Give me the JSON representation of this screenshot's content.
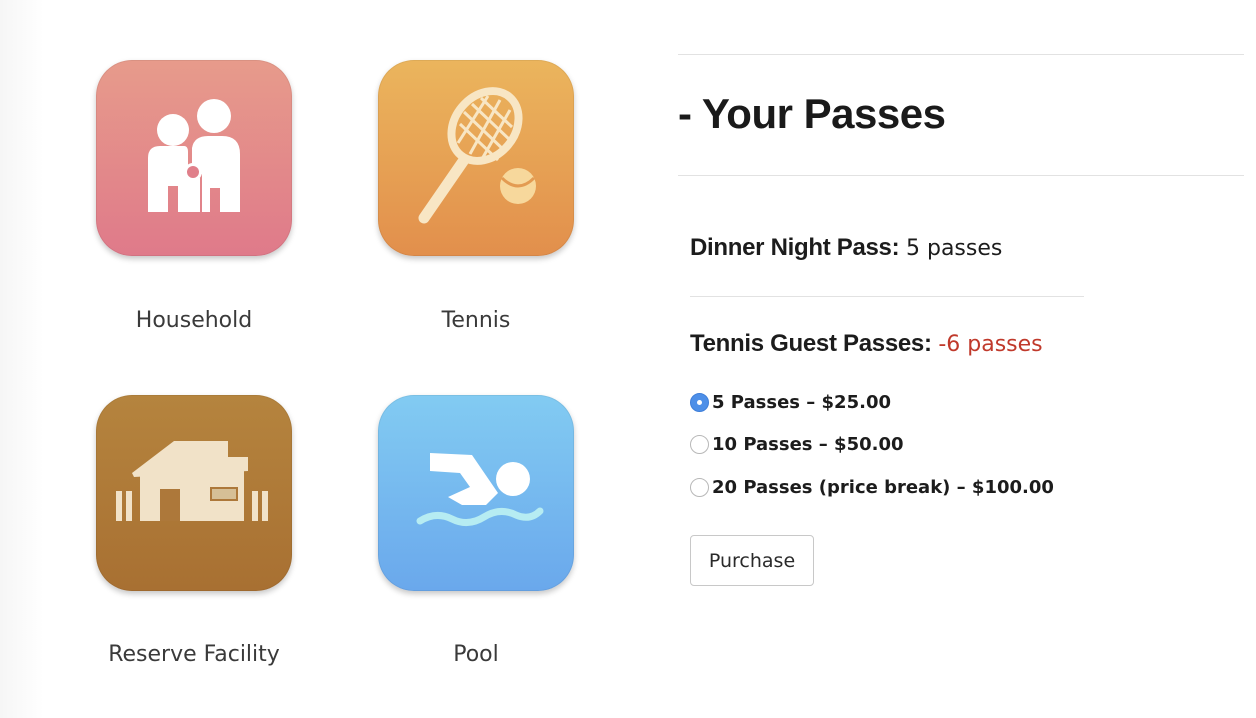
{
  "tiles": [
    {
      "label": "Household",
      "icon": "family-icon",
      "color_top": "#e79b8b",
      "color_bottom": "#df7a8a"
    },
    {
      "label": "Tennis",
      "icon": "tennis-racket-icon",
      "color_top": "#ebb55d",
      "color_bottom": "#e28f4c"
    },
    {
      "label": "Reserve Facility",
      "icon": "clubhouse-icon",
      "color_top": "#b5843e",
      "color_bottom": "#a87032"
    },
    {
      "label": "Pool",
      "icon": "swimmer-icon",
      "color_top": "#82cbf2",
      "color_bottom": "#6aa8ec"
    }
  ],
  "passes": {
    "title": "- Your Passes",
    "dinner": {
      "name": "Dinner Night Pass:",
      "count": "5 passes"
    },
    "tennis": {
      "name": "Tennis Guest Passes:",
      "count": "-6 passes",
      "count_color": "#c0392b"
    },
    "options": [
      {
        "label": "5 Passes – $25.00",
        "selected": true
      },
      {
        "label": "10 Passes – $50.00",
        "selected": false
      },
      {
        "label": "20 Passes (price break) – $100.00",
        "selected": false
      }
    ],
    "purchase_label": "Purchase"
  },
  "accent_color": "#4d8fe8"
}
